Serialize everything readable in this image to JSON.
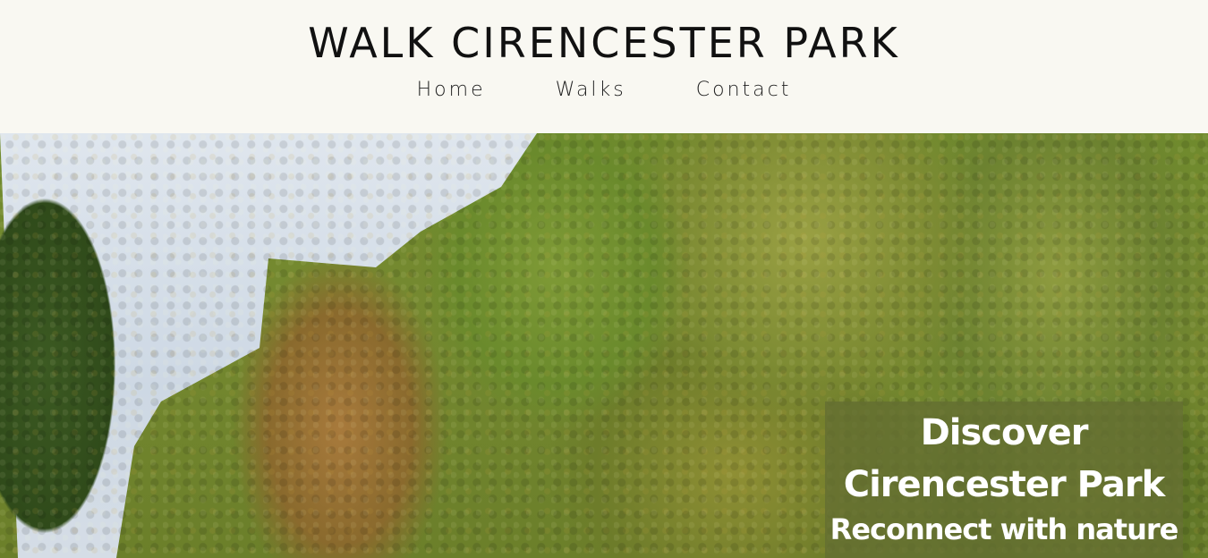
{
  "site": {
    "title": "WALK CIRENCESTER PARK"
  },
  "nav": {
    "items": [
      {
        "label": "Home"
      },
      {
        "label": "Walks"
      },
      {
        "label": "Contact"
      }
    ]
  },
  "hero": {
    "image": "tree-lined-park-avenue",
    "caption": {
      "line1": "Discover",
      "line2": "Cirencester Park",
      "line3": "Reconnect with nature"
    },
    "caption_bg": "#646e32"
  }
}
